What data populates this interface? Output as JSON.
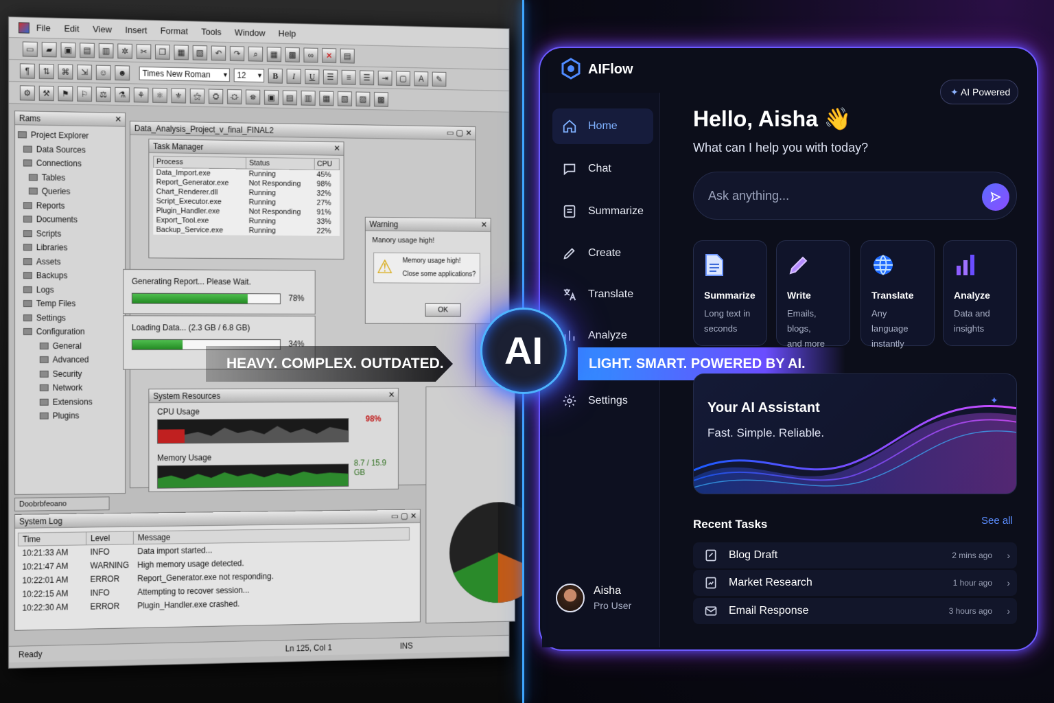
{
  "legacy": {
    "menu": [
      "File",
      "Edit",
      "View",
      "Insert",
      "Format",
      "Tools",
      "Window",
      "Help"
    ],
    "font_name": "Times New Roman",
    "font_size": "12",
    "format_buttons": [
      "B",
      "I",
      "U"
    ],
    "left_panel_title": "Rams",
    "tree": [
      "Project Explorer",
      "Data Sources",
      "Connections",
      "Tables",
      "Queries",
      "Reports",
      "Documents",
      "Scripts",
      "Libraries",
      "Assets",
      "Backups",
      "Logs",
      "Temp Files",
      "Settings",
      "Configuration",
      "General",
      "Advanced",
      "Security",
      "Network",
      "Extensions",
      "Plugins"
    ],
    "doc_title": "Data_Analysis_Project_v_final_FINAL2",
    "task_manager": {
      "title": "Task Manager",
      "columns": [
        "Process",
        "Status",
        "CPU"
      ],
      "rows": [
        [
          "Data_Import.exe",
          "Running",
          "45%"
        ],
        [
          "Report_Generator.exe",
          "Not Responding",
          "98%"
        ],
        [
          "Chart_Renderer.dll",
          "Running",
          "32%"
        ],
        [
          "Script_Executor.exe",
          "Running",
          "27%"
        ],
        [
          "Plugin_Handler.exe",
          "Not Responding",
          "91%"
        ],
        [
          "Export_Tool.exe",
          "Running",
          "33%"
        ],
        [
          "Backup_Service.exe",
          "Running",
          "22%"
        ]
      ]
    },
    "warning": {
      "title": "Warning",
      "heading": "Manory usage high!",
      "line1": "Memory usage high!",
      "line2": "Close some applications?",
      "ok": "OK"
    },
    "progress1": {
      "label": "Generating Report... Please Wait.",
      "value_text": "78%",
      "fraction": 0.78
    },
    "progress2": {
      "label": "Loading Data... (2.3 GB / 6.8 GB)",
      "value_text": "34%",
      "fraction": 0.34
    },
    "tagline": "HEAVY. COMPLEX. OUTDATED.",
    "sysres": {
      "title": "System Resources",
      "cpu_label": "CPU Usage",
      "cpu_value": "98%",
      "mem_label": "Memory Usage",
      "mem_value": "8.7 / 15.9 GB"
    },
    "bottom_tab": "Doobrbfeoano",
    "syslog": {
      "title": "System Log",
      "columns": [
        "Time",
        "Level",
        "Message"
      ],
      "rows": [
        [
          "10:21:33 AM",
          "INFO",
          "Data import started..."
        ],
        [
          "10:21:47 AM",
          "WARNING",
          "High memory usage detected."
        ],
        [
          "10:22:01 AM",
          "ERROR",
          "Report_Generator.exe not responding."
        ],
        [
          "10:22:15 AM",
          "INFO",
          "Attempting to recover session..."
        ],
        [
          "10:22:30 AM",
          "ERROR",
          "Plugin_Handler.exe crashed."
        ]
      ]
    },
    "status": {
      "left": "Ready",
      "pos": "Ln 125, Col 1",
      "mode": "INS"
    }
  },
  "ai_badge": "AI",
  "modern": {
    "app_name": "AIFlow",
    "badge": "AI Powered",
    "nav": [
      "Home",
      "Chat",
      "Summarize",
      "Create",
      "Translate",
      "Analyze",
      "Settings"
    ],
    "greeting": "Hello, Aisha",
    "wave": "👋",
    "subtitle": "What can I help you with today?",
    "search_placeholder": "Ask anything...",
    "cards": [
      {
        "title": "Summarize",
        "desc1": "Long text in",
        "desc2": "seconds",
        "icon": "document-icon"
      },
      {
        "title": "Write",
        "desc1": "Emails, blogs,",
        "desc2": "and more",
        "icon": "pencil-icon"
      },
      {
        "title": "Translate",
        "desc1": "Any language",
        "desc2": "instantly",
        "icon": "globe-icon"
      },
      {
        "title": "Analyze",
        "desc1": "Data and",
        "desc2": "insights",
        "icon": "bar-chart-icon"
      }
    ],
    "tagline": "LIGHT. SMART. POWERED BY AI.",
    "assistant": {
      "title": "Your AI Assistant",
      "subtitle": "Fast. Simple. Reliable."
    },
    "recent_title": "Recent Tasks",
    "see_all": "See all",
    "tasks": [
      {
        "name": "Blog Draft",
        "time": "2 mins ago"
      },
      {
        "name": "Market Research",
        "time": "1 hour ago"
      },
      {
        "name": "Email Response",
        "time": "3 hours ago"
      }
    ],
    "user": {
      "name": "Aisha",
      "plan": "Pro User"
    },
    "colors": {
      "accent": "#4f6bff",
      "purple": "#8b5cff",
      "neon": "#3fa6ff"
    }
  }
}
